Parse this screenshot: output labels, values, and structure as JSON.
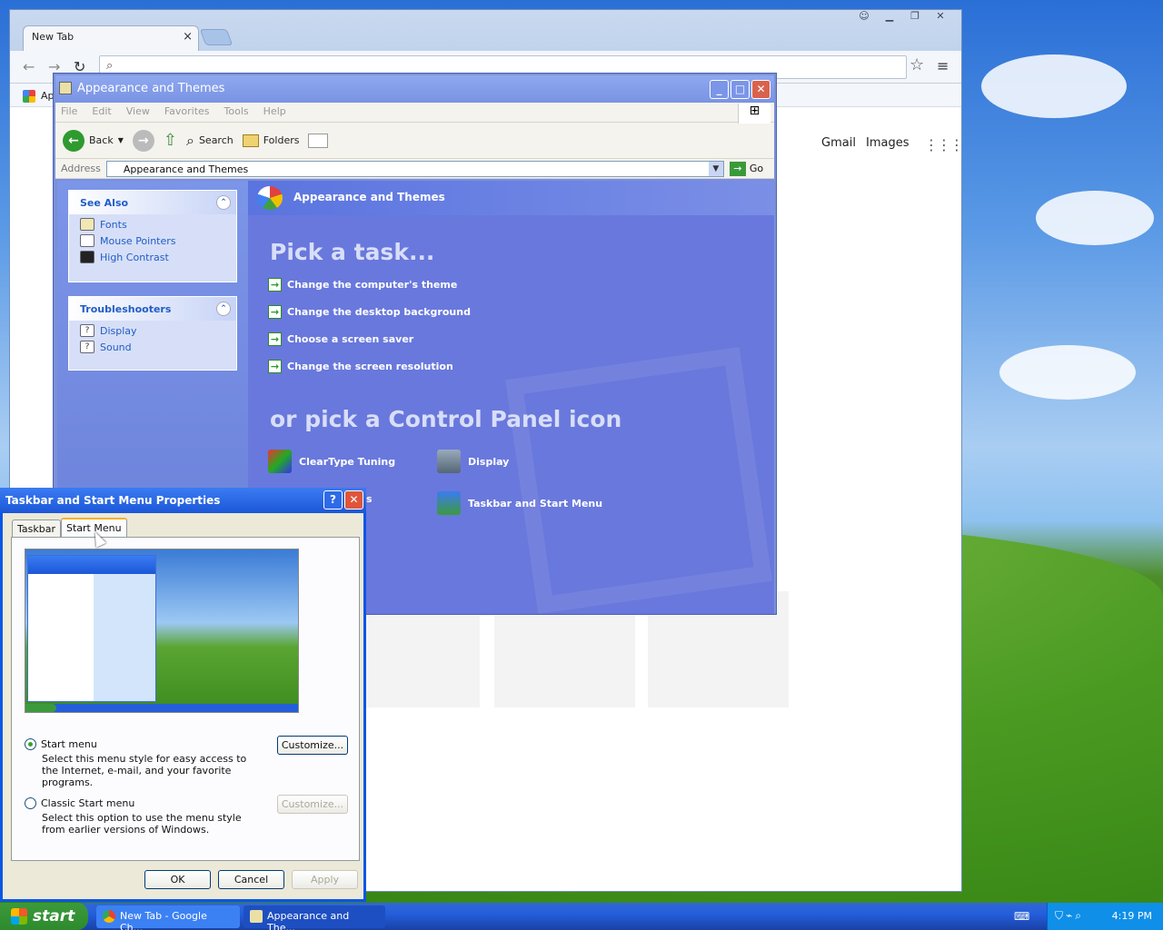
{
  "chrome": {
    "tab_title": "New Tab",
    "tab_close": "×",
    "bookmark_apps": "Ap",
    "gmail": "Gmail",
    "images": "Images"
  },
  "explorer": {
    "title": "Appearance and Themes",
    "menu": [
      "File",
      "Edit",
      "View",
      "Favorites",
      "Tools",
      "Help"
    ],
    "toolbar": {
      "back": "Back",
      "search": "Search",
      "folders": "Folders"
    },
    "address_label": "Address",
    "address_value": "Appearance and Themes",
    "go": "Go",
    "see_also": {
      "title": "See Also",
      "items": [
        "Fonts",
        "Mouse Pointers",
        "High Contrast"
      ]
    },
    "troubleshooters": {
      "title": "Troubleshooters",
      "items": [
        "Display",
        "Sound"
      ]
    },
    "header": "Appearance and Themes",
    "pick_task": "Pick a task...",
    "tasks": [
      "Change the computer's theme",
      "Change the desktop background",
      "Choose a screen saver",
      "Change the screen resolution"
    ],
    "or_pick": "or pick a Control Panel icon",
    "icons": [
      "ClearType Tuning",
      "Display",
      "s",
      "Taskbar and Start Menu"
    ]
  },
  "dialog": {
    "title": "Taskbar and Start Menu Properties",
    "help": "?",
    "close": "✕",
    "tabs": [
      "Taskbar",
      "Start Menu"
    ],
    "option1": {
      "label": "Start menu",
      "desc": "Select this menu style for easy access to the Internet, e-mail, and your favorite programs.",
      "button": "Customize..."
    },
    "option2": {
      "label": "Classic Start menu",
      "desc": "Select this option to use the menu style from earlier versions of Windows.",
      "button": "Customize..."
    },
    "ok": "OK",
    "cancel": "Cancel",
    "apply": "Apply"
  },
  "taskbar": {
    "start": "start",
    "items": [
      "New Tab - Google Ch...",
      "Appearance and The..."
    ],
    "clock": "4:19 PM"
  }
}
